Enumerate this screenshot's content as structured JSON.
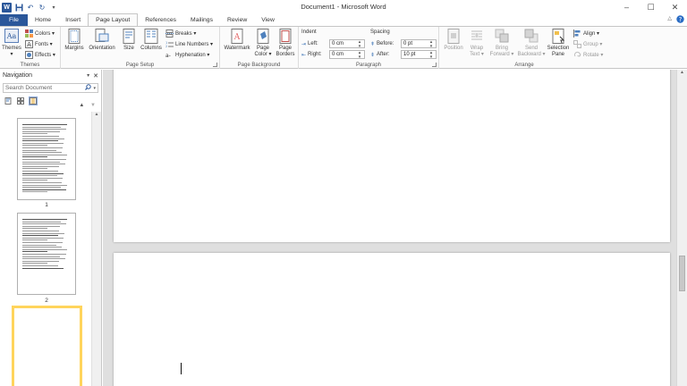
{
  "app": {
    "title": "Document1 - Microsoft Word",
    "logo_letter": "W",
    "accent": "#2b579a"
  },
  "quick_access": {
    "icons": [
      "save-icon",
      "undo-icon",
      "redo-icon",
      "customize-icon"
    ]
  },
  "window_controls": {
    "minimize": "–",
    "maximize": "☐",
    "close": "✕"
  },
  "tabs": [
    {
      "label": "File"
    },
    {
      "label": "Home"
    },
    {
      "label": "Insert"
    },
    {
      "label": "Page Layout"
    },
    {
      "label": "References"
    },
    {
      "label": "Mailings"
    },
    {
      "label": "Review"
    },
    {
      "label": "View"
    }
  ],
  "active_tab": "Page Layout",
  "ribbon": {
    "themes": {
      "label": "Themes",
      "themes_btn": "Themes",
      "colors": "Colors ▾",
      "fonts": "Fonts ▾",
      "effects": "Effects ▾"
    },
    "page_setup": {
      "label": "Page Setup",
      "margins": "Margins",
      "orientation": "Orientation",
      "size": "Size",
      "columns": "Columns",
      "breaks": "Breaks ▾",
      "line_numbers": "Line Numbers ▾",
      "hyphenation": "Hyphenation ▾"
    },
    "page_background": {
      "label": "Page Background",
      "watermark": "Watermark",
      "page_color_1": "Page",
      "page_color_2": "Color ▾",
      "page_borders_1": "Page",
      "page_borders_2": "Borders"
    },
    "paragraph": {
      "label": "Paragraph",
      "indent_title": "Indent",
      "left_label": "Left:",
      "left_value": "0 cm",
      "right_label": "Right:",
      "right_value": "0 cm",
      "spacing_title": "Spacing",
      "before_label": "Before:",
      "before_value": "0 pt",
      "after_label": "After:",
      "after_value": "10 pt"
    },
    "arrange": {
      "label": "Arrange",
      "position": "Position",
      "wrap_1": "Wrap",
      "wrap_2": "Text ▾",
      "bring_1": "Bring",
      "bring_2": "Forward ▾",
      "send_1": "Send",
      "send_2": "Backward ▾",
      "selection_1": "Selection",
      "selection_2": "Pane",
      "align": "Align ▾",
      "group": "Group ▾",
      "rotate": "Rotate ▾"
    }
  },
  "navigation": {
    "title": "Navigation",
    "search_placeholder": "Search Document",
    "pages": [
      {
        "number": "1"
      },
      {
        "number": "2"
      },
      {
        "number": ""
      }
    ]
  }
}
